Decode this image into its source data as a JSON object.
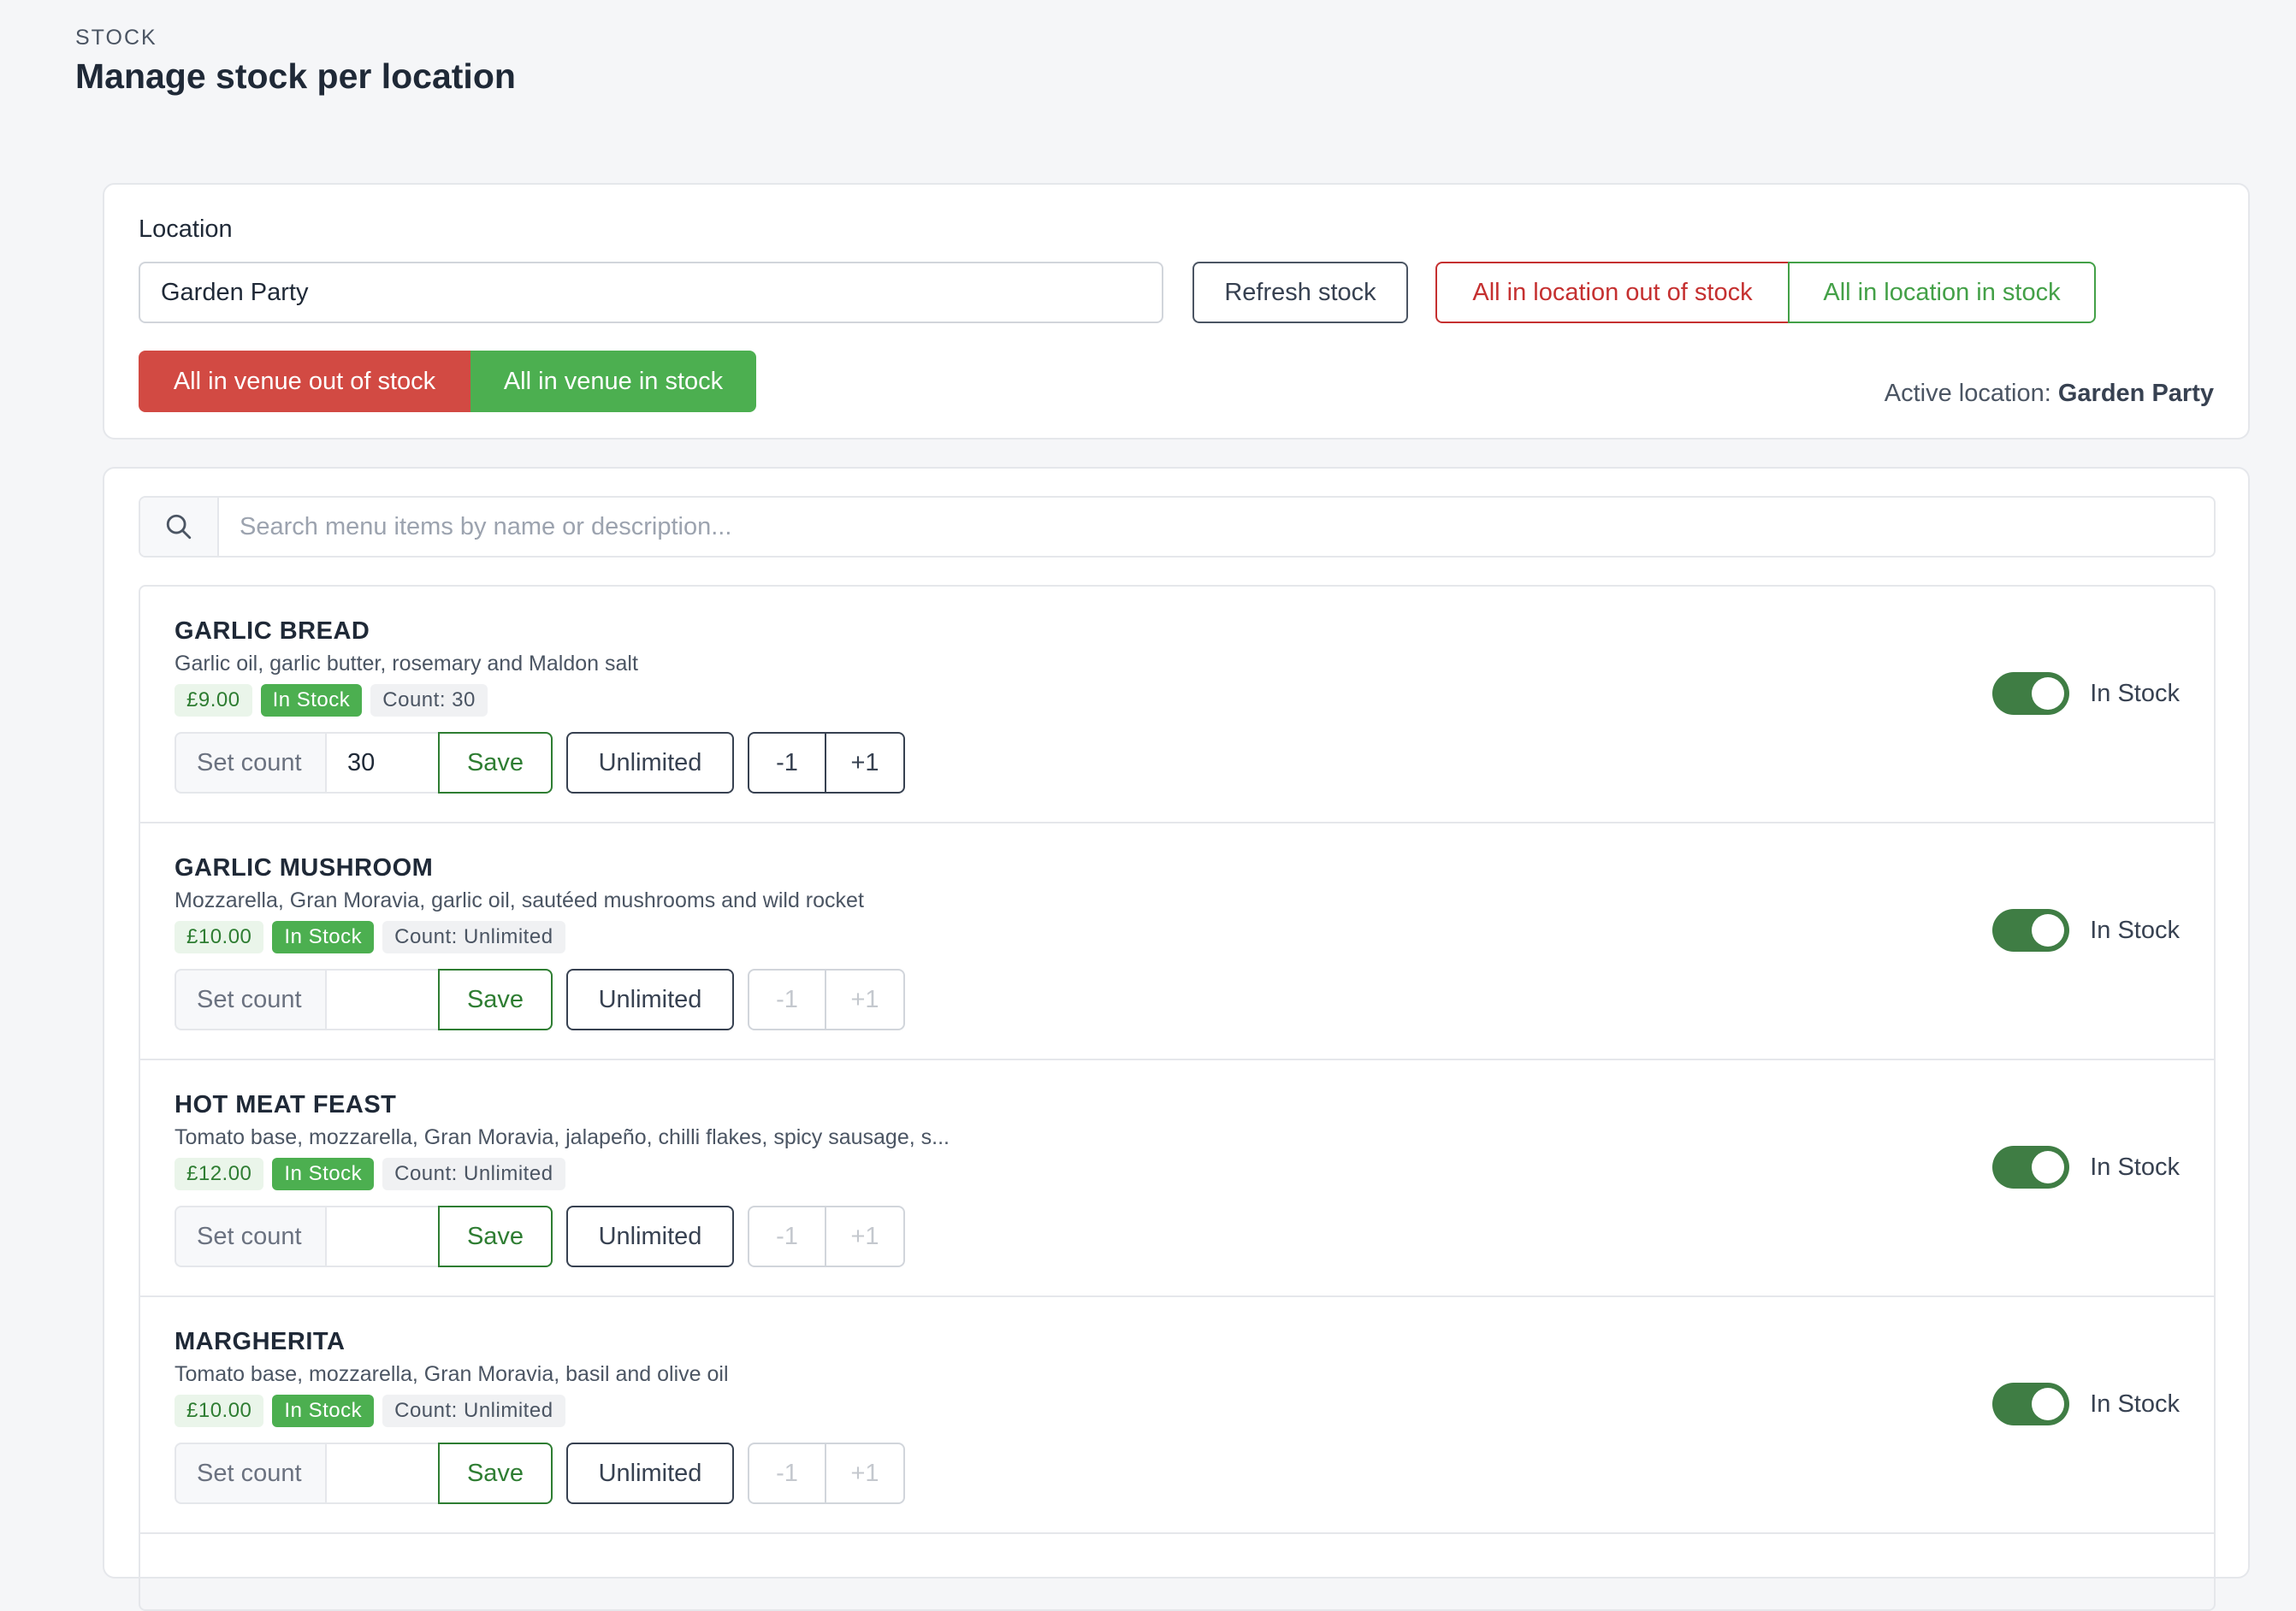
{
  "header": {
    "eyebrow": "STOCK",
    "title": "Manage stock per location"
  },
  "location_panel": {
    "label": "Location",
    "selected_location": "Garden Party",
    "refresh_label": "Refresh stock",
    "loc_out_label": "All in location out of stock",
    "loc_in_label": "All in location in stock",
    "venue_out_label": "All in venue out of stock",
    "venue_in_label": "All in venue in stock",
    "active_prefix": "Active location:",
    "active_value": "Garden Party"
  },
  "search": {
    "placeholder": "Search menu items by name or description..."
  },
  "colors": {
    "accent_green": "#4caf50",
    "accent_red": "#d24a43",
    "toggle_on": "#3f7d44"
  },
  "items": [
    {
      "name": "GARLIC BREAD",
      "description": "Garlic oil, garlic butter, rosemary and Maldon salt",
      "price": "£9.00",
      "stock_badge": "In Stock",
      "count_badge": "Count: 30",
      "set_count_label": "Set count",
      "count_value": "30",
      "save_label": "Save",
      "unlimited_label": "Unlimited",
      "minus_label": "-1",
      "plus_label": "+1",
      "toggle_label": "In Stock"
    },
    {
      "name": "GARLIC MUSHROOM",
      "description": "Mozzarella, Gran Moravia, garlic oil, sautéed mushrooms and wild rocket",
      "price": "£10.00",
      "stock_badge": "In Stock",
      "count_badge": "Count: Unlimited",
      "set_count_label": "Set count",
      "count_value": "",
      "save_label": "Save",
      "unlimited_label": "Unlimited",
      "minus_label": "-1",
      "plus_label": "+1",
      "toggle_label": "In Stock"
    },
    {
      "name": "HOT MEAT FEAST",
      "description": "Tomato base, mozzarella, Gran Moravia, jalapeño, chilli flakes, spicy sausage, s...",
      "price": "£12.00",
      "stock_badge": "In Stock",
      "count_badge": "Count: Unlimited",
      "set_count_label": "Set count",
      "count_value": "",
      "save_label": "Save",
      "unlimited_label": "Unlimited",
      "minus_label": "-1",
      "plus_label": "+1",
      "toggle_label": "In Stock"
    },
    {
      "name": "MARGHERITA",
      "description": "Tomato base, mozzarella, Gran Moravia, basil and olive oil",
      "price": "£10.00",
      "stock_badge": "In Stock",
      "count_badge": "Count: Unlimited",
      "set_count_label": "Set count",
      "count_value": "",
      "save_label": "Save",
      "unlimited_label": "Unlimited",
      "minus_label": "-1",
      "plus_label": "+1",
      "toggle_label": "In Stock"
    }
  ]
}
